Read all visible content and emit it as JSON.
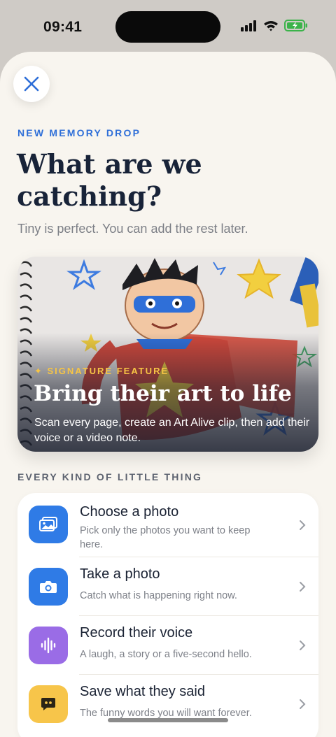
{
  "status": {
    "time": "09:41"
  },
  "header": {
    "eyebrow": "NEW MEMORY DROP",
    "title": "What are we catching?",
    "subtitle": "Tiny is perfect. You can add the rest later."
  },
  "feature": {
    "tag": "✦ SIGNATURE FEATURE",
    "title": "Bring their art to life",
    "description": "Scan every page, create an Art Alive clip, then add their voice or a video note."
  },
  "section_label": "EVERY KIND OF LITTLE THING",
  "options": [
    {
      "title": "Choose a photo",
      "subtitle": "Pick only the photos you want to keep here.",
      "icon": "photos-icon",
      "color": "#2f7be6"
    },
    {
      "title": "Take a photo",
      "subtitle": "Catch what is happening right now.",
      "icon": "camera-icon",
      "color": "#2f7be6"
    },
    {
      "title": "Record their voice",
      "subtitle": "A laugh, a story or a five-second hello.",
      "icon": "waveform-icon",
      "color": "#9a6ce6"
    },
    {
      "title": "Save what they said",
      "subtitle": "The funny words you will want forever.",
      "icon": "quote-bubble-icon",
      "color": "#f7c54a"
    }
  ],
  "colors": {
    "accent": "#2f6fd8",
    "feature_tag": "#f6c445",
    "headline": "#182338",
    "sheet_bg": "#f8f5ef"
  }
}
